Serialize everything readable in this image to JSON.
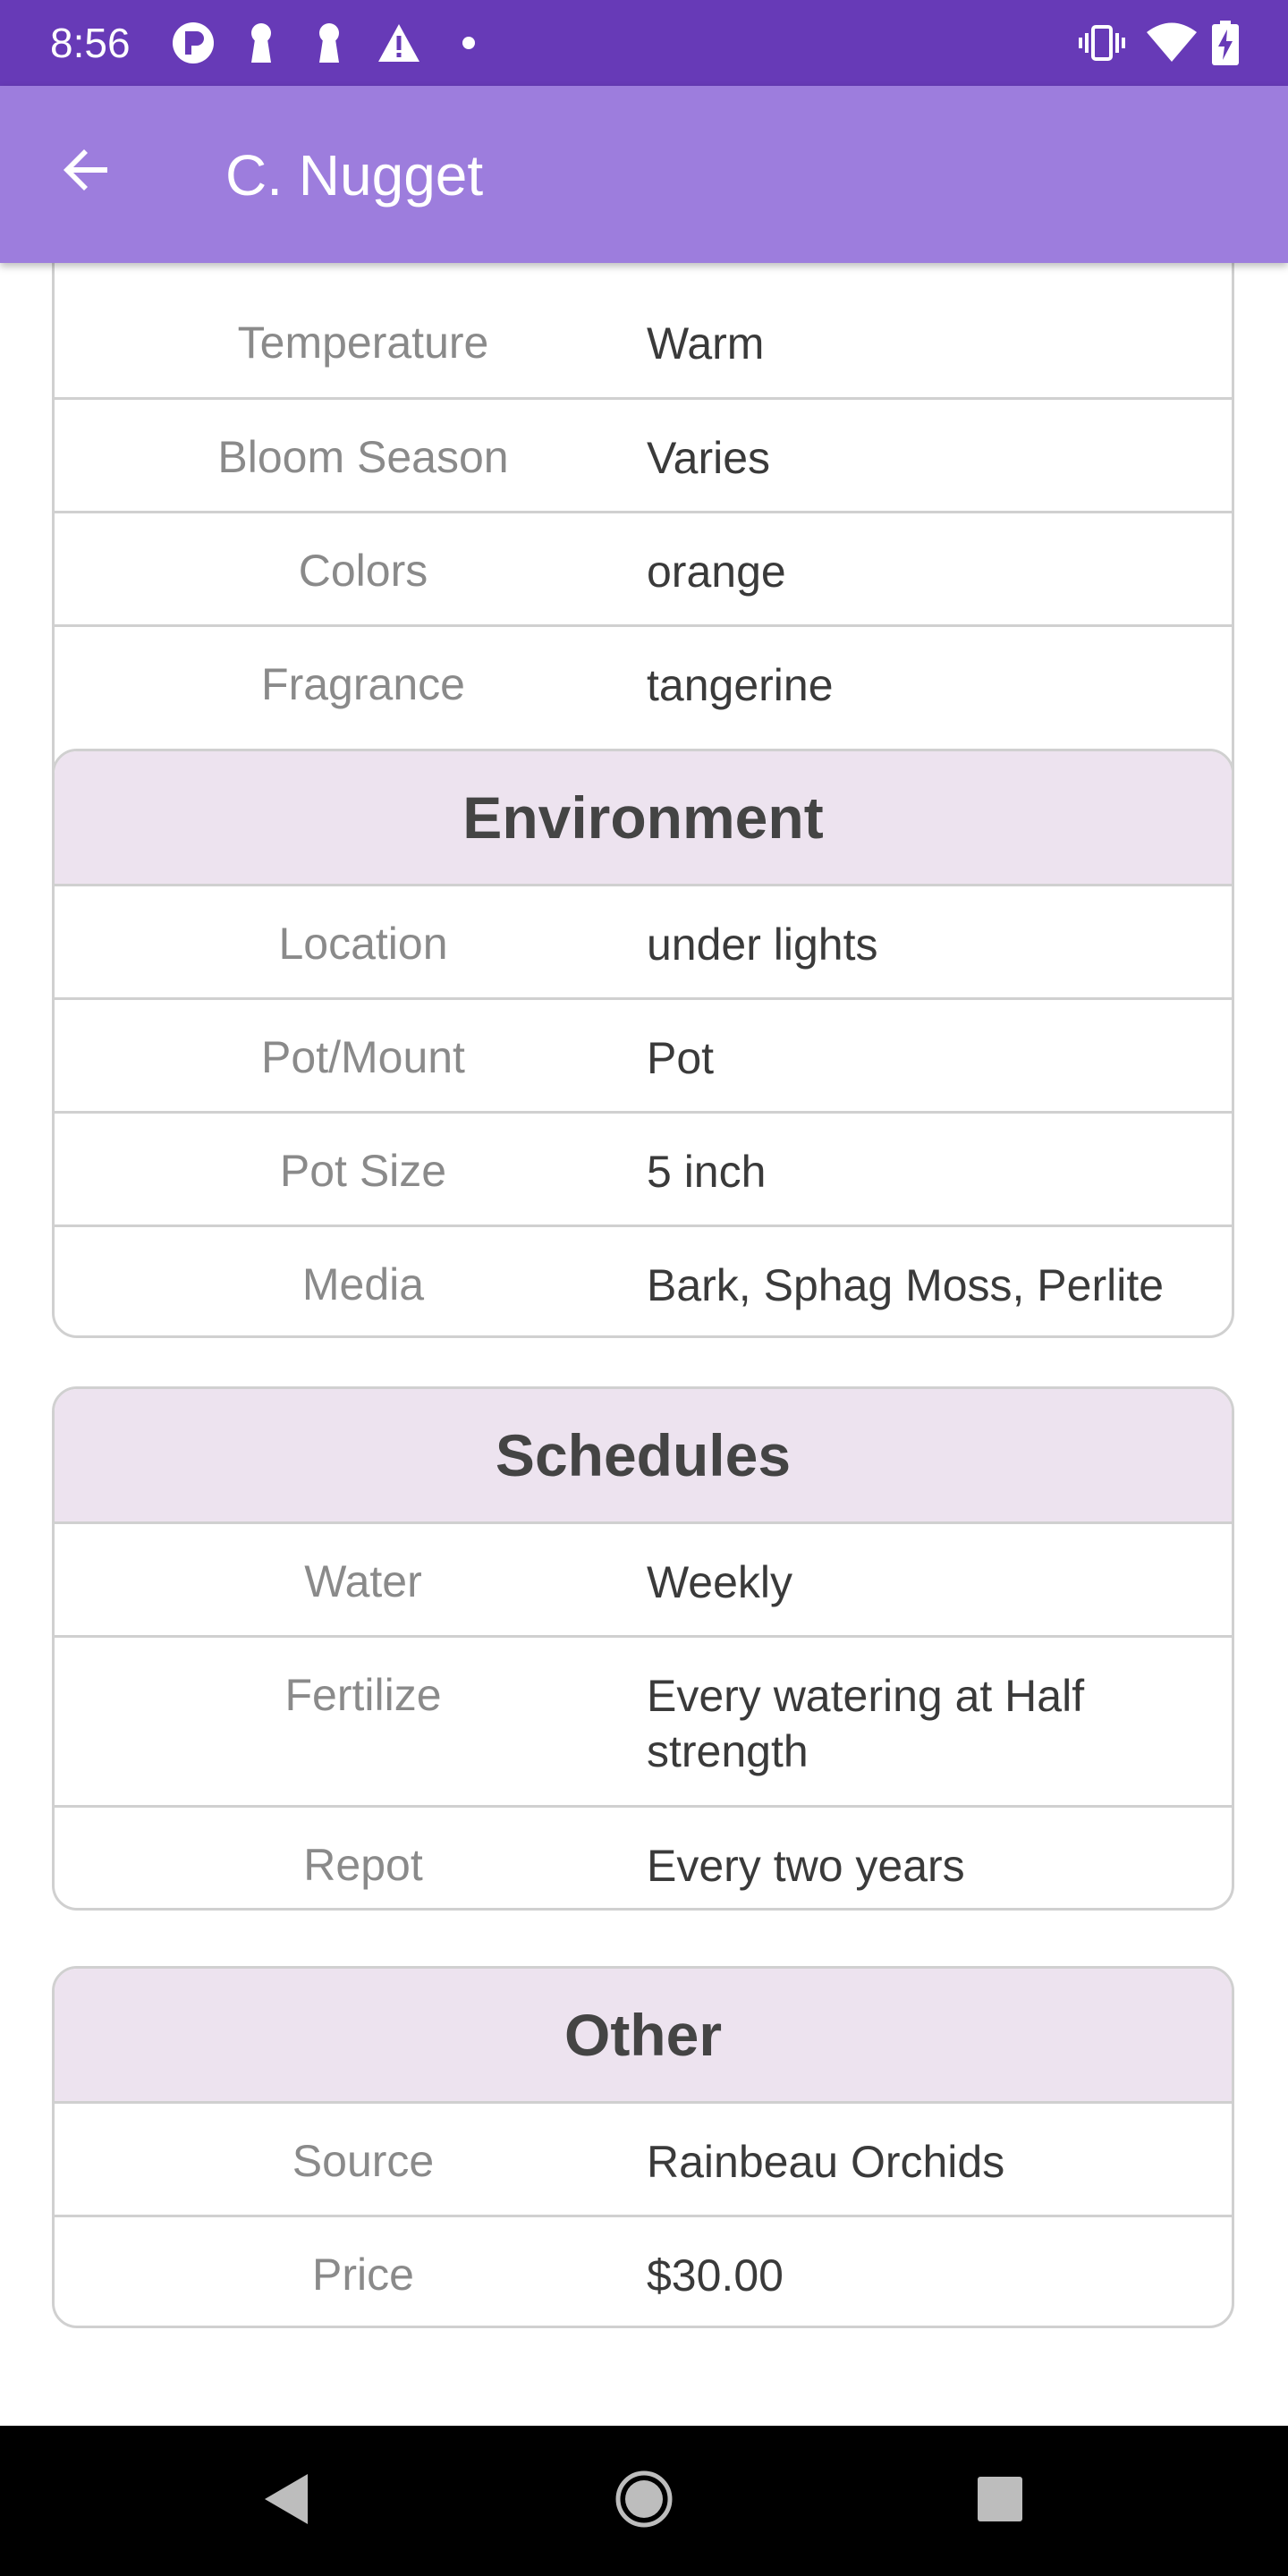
{
  "status_bar": {
    "time": "8:56",
    "icons": [
      "p-logo-icon",
      "keyhole-icon",
      "keyhole-icon",
      "warning-icon",
      "dot-icon",
      "vibrate-icon",
      "wifi-icon",
      "battery-charging-icon"
    ]
  },
  "app_bar": {
    "title": "C. Nugget",
    "back_icon": "arrow-left-icon",
    "background": "#9d7ddd"
  },
  "partial_card": {
    "rows": [
      {
        "label": "Temperature",
        "value": "Warm"
      },
      {
        "label": "Bloom Season",
        "value": "Varies"
      },
      {
        "label": "Colors",
        "value": "orange"
      },
      {
        "label": "Fragrance",
        "value": "tangerine"
      }
    ]
  },
  "environment": {
    "title": "Environment",
    "rows": [
      {
        "label": "Location",
        "value": "under lights"
      },
      {
        "label": "Pot/Mount",
        "value": "Pot"
      },
      {
        "label": "Pot Size",
        "value": "5 inch"
      },
      {
        "label": "Media",
        "value": "Bark, Sphag Moss, Perlite"
      }
    ]
  },
  "schedules": {
    "title": "Schedules",
    "rows": [
      {
        "label": "Water",
        "value": "Weekly"
      },
      {
        "label": "Fertilize",
        "value": "Every watering at Half strength"
      },
      {
        "label": "Repot",
        "value": "Every two years"
      }
    ]
  },
  "other": {
    "title": "Other",
    "rows": [
      {
        "label": "Source",
        "value": "Rainbeau Orchids"
      },
      {
        "label": "Price",
        "value": "$30.00"
      }
    ]
  },
  "colors": {
    "status_bar": "#673ab7",
    "header_bg": "#ede3ef",
    "border": "#d0d0d0"
  }
}
